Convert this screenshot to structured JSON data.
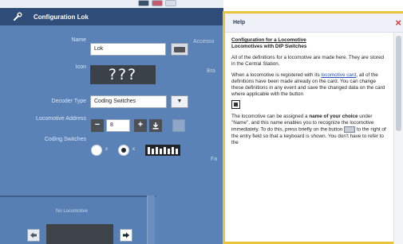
{
  "panel": {
    "title": "Configuration Lok",
    "labels": {
      "name": "Name",
      "icon": "Icon",
      "decoder_type": "Decoder Type",
      "address": "Locomotive Address",
      "coding_switches": "Coding Switches"
    },
    "cut_labels": [
      "Accesso",
      "Bra",
      "Fa"
    ],
    "name_value": "Lok",
    "icon_placeholder": "???",
    "decoder_type_value": "Coding Switches",
    "address_value": "8",
    "minus": "−",
    "plus": "+",
    "radio_marks": [
      "x",
      "x"
    ],
    "no_locomotive_label": "No Locomotive"
  },
  "help": {
    "title": "Help",
    "close": "×",
    "heading": "Configuration for a Locomotive",
    "subheading": "Locomotives with DIP Switches",
    "p1": "All of the definitions for a locomotive are made here. They are stored in the Central Station.",
    "p2_a": "When a locomotive is registered with its ",
    "p2_link": "locomotive card",
    "p2_b": ", all of the definitions have been made already on the card. You can change these definitions in any event and save the changed data on the card where applicable with the button",
    "p3_a": "The locomotive can be assigned a ",
    "p3_bold": "name of your choice",
    "p3_b": " under \"Name\", and this name enables you to recognize the locomotive immediately. To do this, press briefly on the button",
    "p3_c": " to the right of the entry field so that a keyboard is shown. You don't have to refer to the"
  },
  "colors": {
    "panel_bg": "#5a82b6",
    "header_bg": "#2f4d78",
    "help_border": "#e8c43a",
    "close_red": "#d33b3b"
  },
  "icons": [
    "wrench-icon",
    "keyboard-icon",
    "dropdown-icon",
    "save-card-icon",
    "arrow-left-icon",
    "arrow-right-icon",
    "dip-switch-icon",
    "close-icon"
  ]
}
